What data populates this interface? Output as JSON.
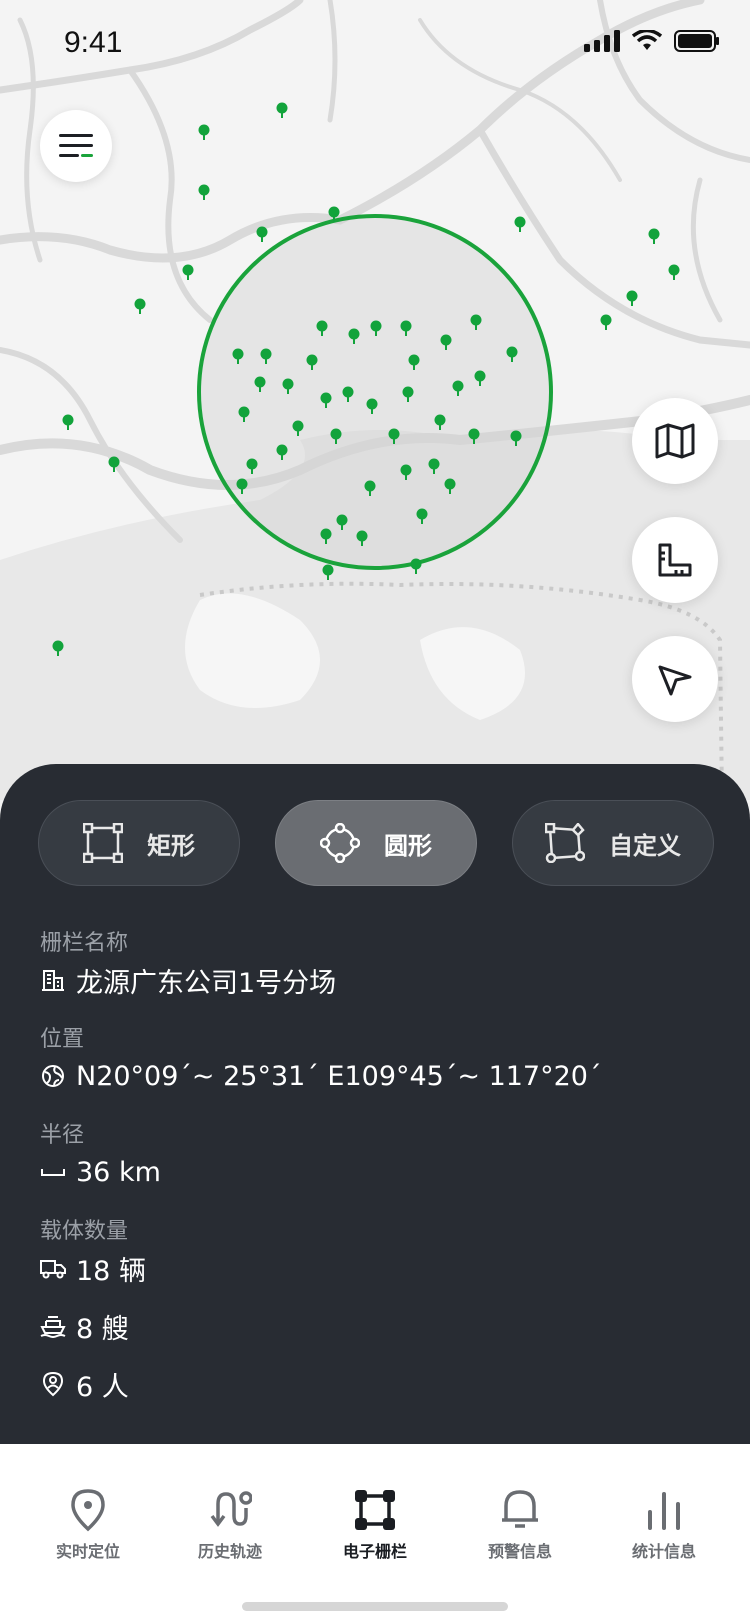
{
  "status": {
    "time": "9:41"
  },
  "map": {
    "fence_color": "#1aa33b",
    "marker_color": "#12a33b",
    "markers_count_hint": "many"
  },
  "shape_tabs": [
    {
      "label": "矩形",
      "icon": "rectangle-icon",
      "active": false
    },
    {
      "label": "圆形",
      "icon": "circle-shape-icon",
      "active": true
    },
    {
      "label": "自定义",
      "icon": "custom-shape-icon",
      "active": false
    }
  ],
  "info": {
    "name_label": "栅栏名称",
    "name_value": "龙源广东公司1号分场",
    "position_label": "位置",
    "position_value": "N20°09´~ 25°31´  E109°45´~ 117°20´",
    "radius_label": "半径",
    "radius_value": "36 km",
    "count_label": "载体数量",
    "vehicles": "18 辆",
    "ships": "8 艘",
    "people": "6 人"
  },
  "tabbar": [
    {
      "label": "实时定位",
      "icon": "location-pin-icon",
      "active": false
    },
    {
      "label": "历史轨迹",
      "icon": "route-icon",
      "active": false
    },
    {
      "label": "电子栅栏",
      "icon": "fence-icon",
      "active": true
    },
    {
      "label": "预警信息",
      "icon": "bell-icon",
      "active": false
    },
    {
      "label": "统计信息",
      "icon": "bar-chart-icon",
      "active": false
    }
  ],
  "colors": {
    "panel": "#282c33",
    "accent": "#1aa33b"
  }
}
